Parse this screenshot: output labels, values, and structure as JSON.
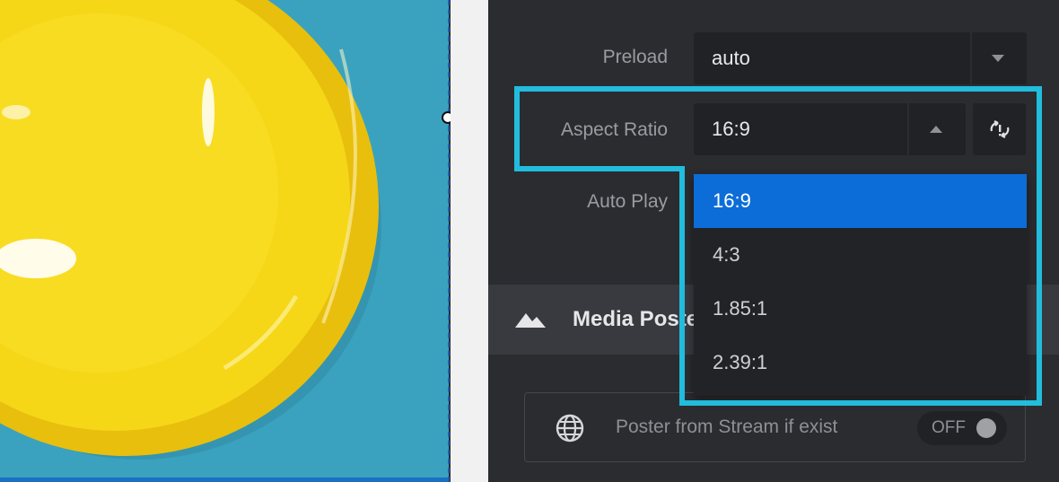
{
  "panel": {
    "preload": {
      "label": "Preload",
      "value": "auto",
      "caret": "chevron-down-icon"
    },
    "aspect_ratio": {
      "label": "Aspect Ratio",
      "value": "16:9",
      "caret": "chevron-up-icon",
      "reset_icon": "reset-icon",
      "options": [
        {
          "label": "16:9",
          "selected": true
        },
        {
          "label": "4:3",
          "selected": false
        },
        {
          "label": "1.85:1",
          "selected": false
        },
        {
          "label": "2.39:1",
          "selected": false
        }
      ]
    },
    "auto_play": {
      "label": "Auto Play"
    },
    "section": {
      "title": "Media Poster",
      "icon": "mountain-icon"
    },
    "poster_option": {
      "label": "Poster from Stream if exist",
      "icon": "globe-icon",
      "toggle_label": "OFF"
    }
  },
  "colors": {
    "panel_bg": "#2b2c30",
    "field_bg": "#212226",
    "selected_option": "#0c6dd8",
    "highlight": "#22bcdc",
    "canvas_bg": "#3aa2bf",
    "bowl": "#f2d214"
  }
}
